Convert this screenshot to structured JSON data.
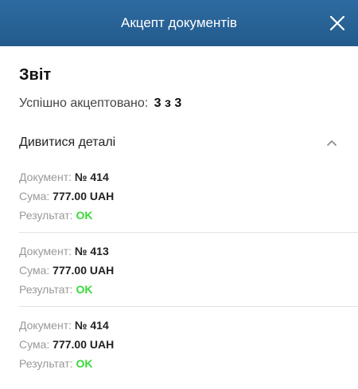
{
  "header": {
    "title": "Акцепт документів"
  },
  "report": {
    "title": "Звіт",
    "summary_label": "Успішно акцептовано:",
    "summary_value": "3 з 3",
    "details_toggle": "Дивитися деталі"
  },
  "documents": [
    {
      "doc_label": "Документ:",
      "doc_number": "№ 414",
      "amount_label": "Сума:",
      "amount": "777.00 UAH",
      "result_label": "Результат:",
      "result": "OK"
    },
    {
      "doc_label": "Документ:",
      "doc_number": "№ 413",
      "amount_label": "Сума:",
      "amount": "777.00 UAH",
      "result_label": "Результат:",
      "result": "OK"
    },
    {
      "doc_label": "Документ:",
      "doc_number": "№ 414",
      "amount_label": "Сума:",
      "amount": "777.00 UAH",
      "result_label": "Результат:",
      "result": "OK"
    }
  ],
  "colors": {
    "header_bg": "#2b6699",
    "result_ok": "#3ad83a"
  },
  "icons": {
    "close": "close-icon",
    "collapse": "chevron-up-icon"
  }
}
